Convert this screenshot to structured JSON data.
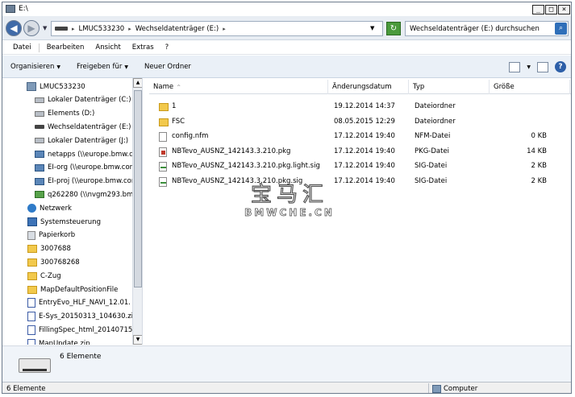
{
  "window": {
    "title": "E:\\"
  },
  "address": {
    "crumbs": [
      "LMUC533230",
      "Wechseldatenträger (E:)"
    ],
    "search_placeholder": "Wechseldatenträger (E:) durchsuchen"
  },
  "menu": {
    "items": [
      "Datei",
      "Bearbeiten",
      "Ansicht",
      "Extras",
      "?"
    ]
  },
  "commands": {
    "organize": "Organisieren",
    "share": "Freigeben für",
    "new_folder": "Neuer Ordner"
  },
  "tree": {
    "items": [
      {
        "label": "LMUC533230",
        "icon": "computer-icon"
      },
      {
        "label": "Lokaler Datenträger (C:)",
        "icon": "hdd-icon"
      },
      {
        "label": "Elements (D:)",
        "icon": "hdd-icon"
      },
      {
        "label": "Wechseldatenträger (E:)",
        "icon": "usb-drive-icon"
      },
      {
        "label": "Lokaler Datenträger (J:)",
        "icon": "hdd-icon"
      },
      {
        "label": "netapps (\\\\europe.bmw.c",
        "icon": "network-drive-icon"
      },
      {
        "label": "EI-org (\\\\europe.bmw.cor",
        "icon": "network-drive-icon"
      },
      {
        "label": "EI-proj (\\\\europe.bmw.cor",
        "icon": "network-drive-icon"
      },
      {
        "label": "q262280 (\\\\nvgm293.bmw",
        "icon": "network-drive-icon"
      },
      {
        "label": "Netzwerk",
        "icon": "network-icon"
      },
      {
        "label": "Systemsteuerung",
        "icon": "control-panel-icon"
      },
      {
        "label": "Papierkorb",
        "icon": "recycle-bin-icon"
      },
      {
        "label": "3007688",
        "icon": "folder-icon"
      },
      {
        "label": "300768268",
        "icon": "folder-icon"
      },
      {
        "label": "C-Zug",
        "icon": "folder-icon"
      },
      {
        "label": "MapDefaultPositionFile",
        "icon": "folder-icon"
      },
      {
        "label": "EntryEvo_HLF_NAVI_12.01.",
        "icon": "zip-icon"
      },
      {
        "label": "E-Sys_20150313_104630.zi",
        "icon": "zip-icon"
      },
      {
        "label": "FillingSpec_html_20140715.",
        "icon": "zip-icon"
      },
      {
        "label": "MapUpdate.zip",
        "icon": "zip-icon"
      }
    ]
  },
  "columns": {
    "name": "Name",
    "date": "Änderungsdatum",
    "type": "Typ",
    "size": "Größe"
  },
  "files": [
    {
      "name": "1",
      "date": "19.12.2014 14:37",
      "type": "Dateiordner",
      "size": "",
      "icon": "folder-icon"
    },
    {
      "name": "FSC",
      "date": "08.05.2015 12:29",
      "type": "Dateiordner",
      "size": "",
      "icon": "folder-icon"
    },
    {
      "name": "config.nfm",
      "date": "17.12.2014 19:40",
      "type": "NFM-Datei",
      "size": "0 KB",
      "icon": "document-icon"
    },
    {
      "name": "NBTevo_AUSNZ_142143.3.210.pkg",
      "date": "17.12.2014 19:40",
      "type": "PKG-Datei",
      "size": "14 KB",
      "icon": "package-icon"
    },
    {
      "name": "NBTevo_AUSNZ_142143.3.210.pkg.light.sig",
      "date": "17.12.2014 19:40",
      "type": "SIG-Datei",
      "size": "2 KB",
      "icon": "signature-icon"
    },
    {
      "name": "NBTevo_AUSNZ_142143.3.210.pkg.sig",
      "date": "17.12.2014 19:40",
      "type": "SIG-Datei",
      "size": "2 KB",
      "icon": "signature-icon"
    }
  ],
  "watermark": {
    "cn": "宝马汇",
    "latin": "BMWCHE.CN"
  },
  "details": {
    "count": "6 Elemente"
  },
  "status": {
    "left": "6 Elemente",
    "right": "Computer"
  }
}
